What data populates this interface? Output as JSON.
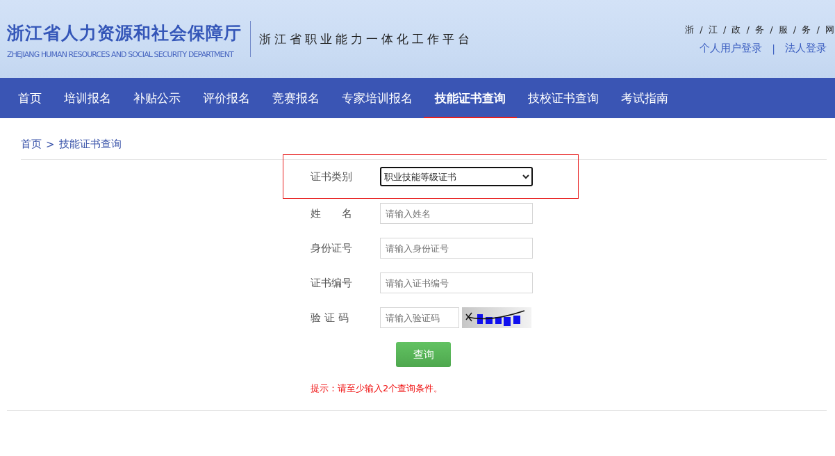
{
  "header": {
    "org_name": "浙江省人力资源和社会保障厅",
    "org_name_en": "ZHEJIANG HUMAN RESOURCES AND SOCIAL SECURITY DEPARTMENT",
    "platform": "浙江省职业能力一体化工作平台",
    "gov_link": "浙 / 江 / 政 / 务 / 服 / 务 / 网",
    "login_links": [
      "个人用户登录",
      "法人登录"
    ],
    "login_separator": "|"
  },
  "nav": [
    {
      "label": "首页",
      "selected": false
    },
    {
      "label": "培训报名",
      "selected": false
    },
    {
      "label": "补贴公示",
      "selected": false
    },
    {
      "label": "评价报名",
      "selected": false
    },
    {
      "label": "竞赛报名",
      "selected": false
    },
    {
      "label": "专家培训报名",
      "selected": false
    },
    {
      "label": "技能证书查询",
      "selected": true
    },
    {
      "label": "技校证书查询",
      "selected": false
    },
    {
      "label": "考试指南",
      "selected": false
    }
  ],
  "breadcrumb": [
    "首页",
    "技能证书查询"
  ],
  "breadcrumb_separator": ">",
  "form": {
    "fields": [
      {
        "kind": "select",
        "label": "证书类别",
        "value": "职业技能等级证书",
        "highlighted": true
      },
      {
        "kind": "text",
        "label": "姓　　名",
        "placeholder": "请输入姓名",
        "highlighted": false
      },
      {
        "kind": "text",
        "label": "身份证号",
        "placeholder": "请输入身份证号",
        "highlighted": false
      },
      {
        "kind": "text",
        "label": "证书编号",
        "placeholder": "请输入证书编号",
        "highlighted": false
      },
      {
        "kind": "captcha",
        "label": "验 证 码",
        "placeholder": "请输入验证码",
        "highlighted": false
      }
    ],
    "submit": "查询",
    "hint": "提示：请至少输入2个查询条件。"
  }
}
